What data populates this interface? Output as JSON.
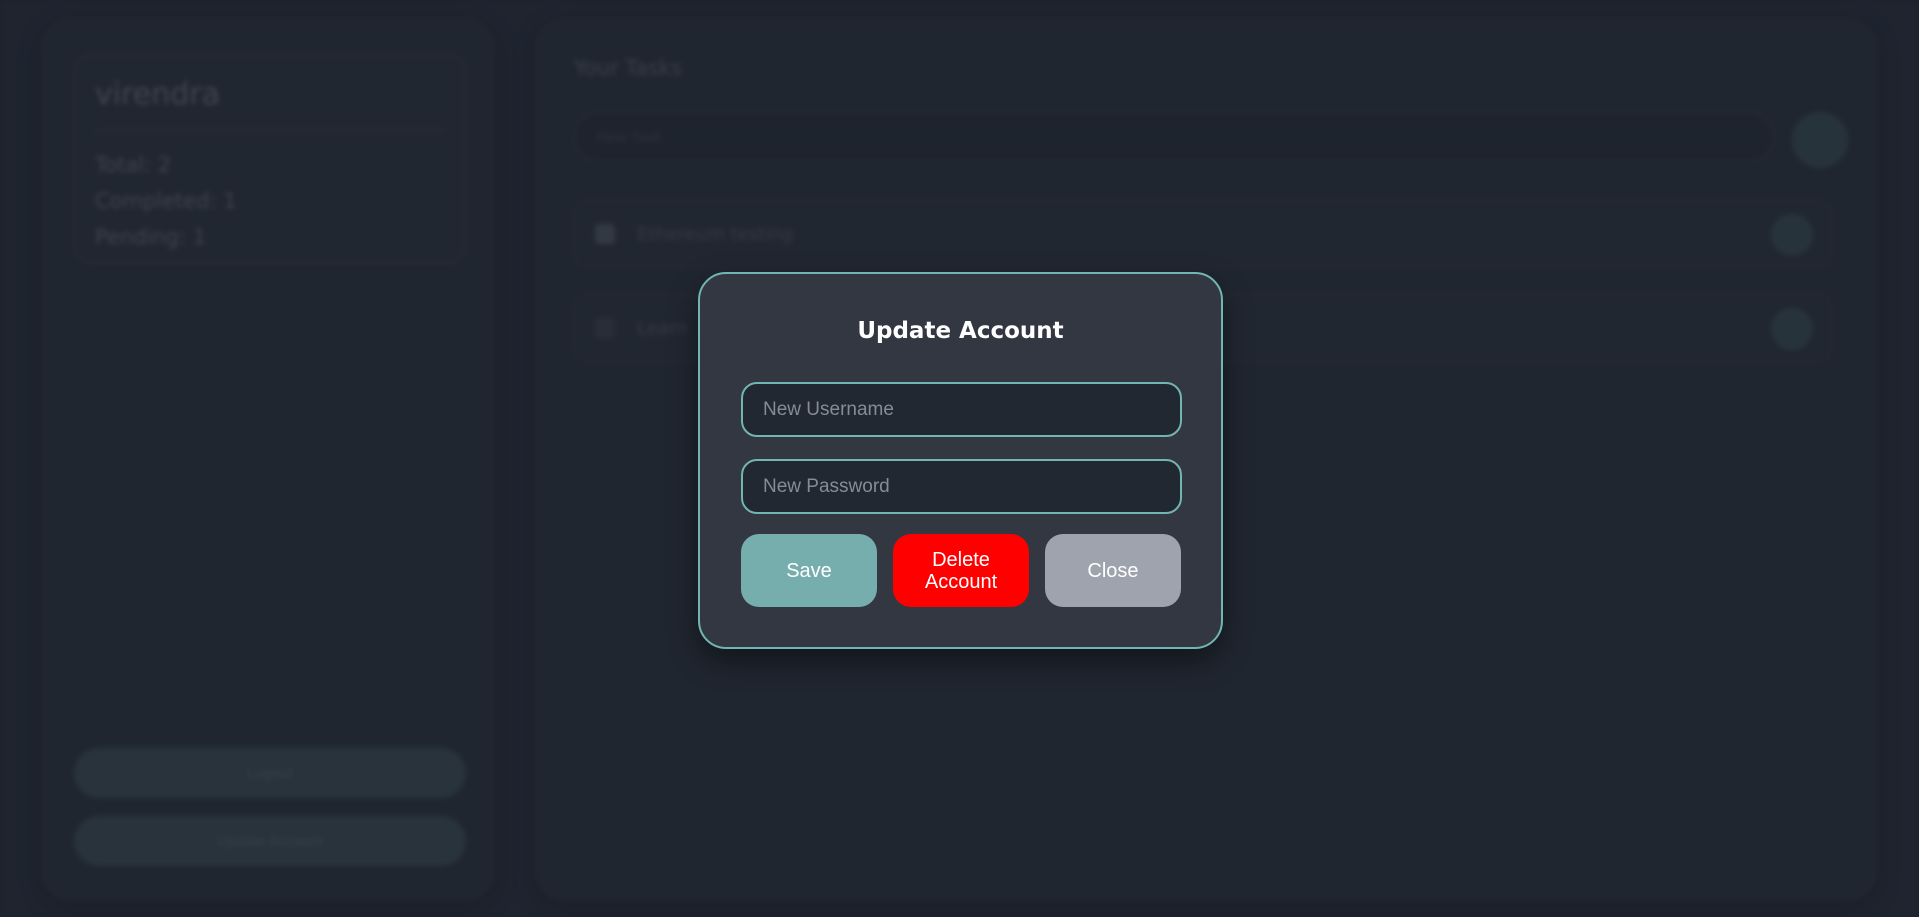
{
  "sidebar": {
    "username": "virendra",
    "stats": [
      "Total: 2",
      "Completed: 1",
      "Pending: 1"
    ],
    "buttons": [
      "Logout",
      "Update Account"
    ]
  },
  "main": {
    "title": "Your Tasks",
    "new_task_placeholder": "New Task",
    "tasks": [
      {
        "text": "Ethereum testing",
        "completed": true
      },
      {
        "text": "Learn",
        "completed": false
      }
    ]
  },
  "modal": {
    "title": "Update Account",
    "username_placeholder": "New Username",
    "password_placeholder": "New Password",
    "save_label": "Save",
    "delete_label": "Delete Account",
    "close_label": "Close",
    "colors": {
      "accent": "#72b5b2",
      "save": "#76aeae",
      "delete": "#ff0000",
      "close": "#9fa3ae"
    }
  }
}
